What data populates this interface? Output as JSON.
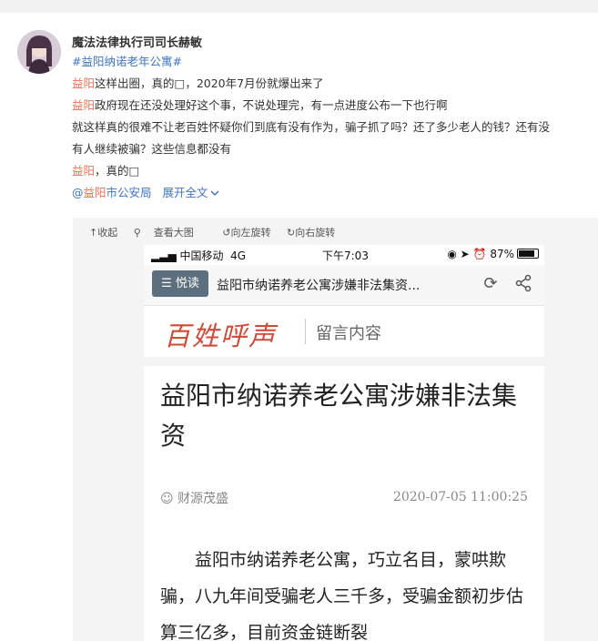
{
  "post": {
    "username": "魔法法律执行司司长赫敏",
    "hashtag": "#益阳纳诺老年公寓#",
    "line1_hl": "益阳",
    "line1_rest": "这样出圈，真的□，2020年7月份就爆出来了",
    "line2_hl": "益阳",
    "line2_rest": "政府现在还没处理好这个事，不说处理完，有一点进度公布一下也行啊",
    "line3": "就这样真的很难不让老百姓怀疑你们到底有没有作为，骗子抓了吗？还了多少老人的钱？还有没",
    "line4": "有人继续被骗？这些信息都没有",
    "line5_hl": "益阳",
    "line5_rest": "，真的□",
    "mention_at": "@",
    "mention_hl": "益阳",
    "mention_rest": "市公安局",
    "expand": "展开全文",
    "expand_icon": "chevron-down-icon"
  },
  "image_toolbar": {
    "collapse": "↑收起",
    "view_large": "查看大图",
    "rotate_left": "↺向左旋转",
    "rotate_right": "↻向右旋转"
  },
  "phone": {
    "carrier": "中国移动",
    "network": "4G",
    "time": "下午7:03",
    "battery": "87%",
    "yuedu": "悦读",
    "nav_title": "益阳市纳诺养老公寓涉嫌非法集资...",
    "brand": "百姓呼声",
    "subtitle": "留言内容",
    "article_title": "益阳市纳诺养老公寓涉嫌非法集资",
    "author": "财源茂盛",
    "date": "2020-07-05 11:00:25",
    "body": "益阳市纳诺养老公寓，巧立名目，蒙哄欺骗，八九年间受骗老人三千多，受骗金额初步估算三亿多，目前资金链断裂"
  }
}
